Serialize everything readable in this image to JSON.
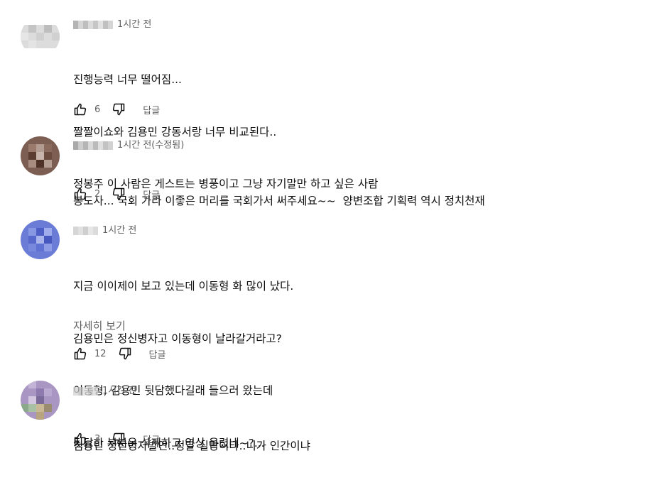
{
  "comments": [
    {
      "author_blurred": "바보쿨쿨이",
      "time": "1시간 전",
      "lines": [
        "진행능력 너무 떨어짐...",
        "짤짤이쇼와 김용민 강동서랑 너무 비교된다..",
        "정봉주 이 사람은 게스트는 병풍이고 그냥 자기말만 하고 싶은 사람"
      ],
      "likes": "6",
      "reply_label": "답글",
      "avatar_colors": [
        "#e8e8e8",
        "#d6d6d6",
        "#c9c9c9",
        "#bdbdbd",
        "#d8d8d8"
      ]
    },
    {
      "author_blurred": "",
      "time": "1시간 전(수정됨)",
      "lines": [
        "봉도사... 국회 가라 이좋은 머리를 국회가서 써주세요~~  양변조합 기획력 역시 정치천재"
      ],
      "likes": "2",
      "reply_label": "답글",
      "avatar_colors": [
        "#6f4a3c",
        "#8c6b5e",
        "#a48a7f",
        "#5a3a2e",
        "#b9a39a"
      ]
    },
    {
      "author_blurred": "",
      "time": "1시간 전",
      "lines": [
        "지금 이이제이 보고 있는데 이동형 화 많이 났다.",
        "김용민은 정신병자고 이동형이 날라갈거라고?",
        "이동형, 김용민 뒷담했다길래 들으러 왔는데",
        "뒷담한 부분은 삭제하고 영상 올렸네~?..."
      ],
      "more_label": "자세히 보기",
      "likes": "12",
      "reply_label": "답글",
      "avatar_colors": [
        "#5a6ed0",
        "#7a8be0",
        "#4b5cc4",
        "#9aa6e8",
        "#6477d6"
      ]
    },
    {
      "author_blurred": "",
      "time": "1시간 전",
      "lines": [
        "김용민 정신병자발언..정말 실망이다..니가 인간이냐"
      ],
      "likes": "3",
      "reply_label": "답글",
      "avatar_colors": [
        "#9a84b8",
        "#b7a6cc",
        "#7c9a7a",
        "#c9b89a",
        "#8a7aa8"
      ]
    }
  ],
  "icons": {
    "like": "thumbs-up-icon",
    "dislike": "thumbs-down-icon"
  }
}
